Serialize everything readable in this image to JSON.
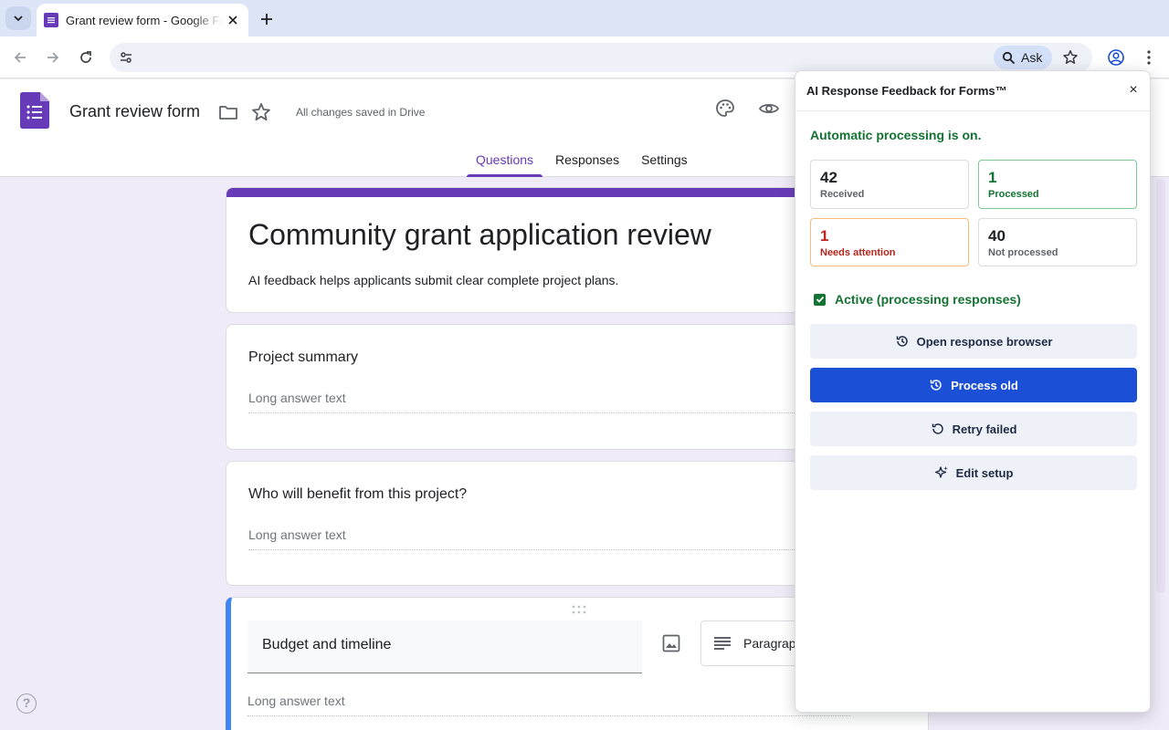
{
  "browser": {
    "tab_title": "Grant review form - Google Forms",
    "ask_label": "Ask"
  },
  "forms": {
    "doc_title": "Grant review form",
    "save_status": "All changes saved in Drive",
    "tabs": [
      "Questions",
      "Responses",
      "Settings"
    ],
    "active_tab": "Questions",
    "accent_color": "#673ab7"
  },
  "form": {
    "title": "Community grant application review",
    "description": "AI feedback helps applicants submit clear complete project plans.",
    "questions": [
      {
        "title": "Project summary",
        "answer_placeholder": "Long answer text"
      },
      {
        "title": "Who will benefit from this project?",
        "answer_placeholder": "Long answer text"
      },
      {
        "title": "Budget and timeline",
        "answer_placeholder": "Long answer text",
        "type": "Paragraph"
      }
    ]
  },
  "extension": {
    "title": "AI Response Feedback for Forms™",
    "close_label": "×",
    "status": "Automatic processing is on.",
    "stats": {
      "received": {
        "value": "42",
        "label": "Received"
      },
      "processed": {
        "value": "1",
        "label": "Processed"
      },
      "needs_attention": {
        "value": "1",
        "label": "Needs attention"
      },
      "not_processed": {
        "value": "40",
        "label": "Not processed"
      }
    },
    "active_label": "Active (processing responses)",
    "active_checked": true,
    "buttons": {
      "open_browser": "Open response browser",
      "process_old": "Process old",
      "retry_failed": "Retry failed",
      "edit_setup": "Edit setup"
    },
    "primary_color": "#1a4fd6",
    "success_color": "#137333"
  }
}
